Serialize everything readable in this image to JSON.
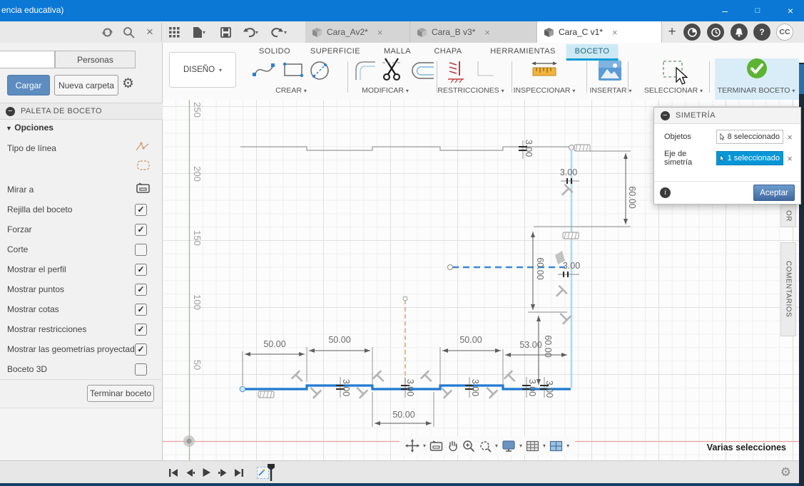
{
  "window": {
    "title_partial": "encia educativa)"
  },
  "header": {
    "doc_tabs": [
      {
        "label": "Cara_Av2*"
      },
      {
        "label": "Cara_B v3*"
      },
      {
        "label": "Cara_C v1*"
      }
    ],
    "avatar": "CC"
  },
  "ribbon": {
    "design_menu": "DISEÑO",
    "tabs": [
      {
        "label": "SOLIDO"
      },
      {
        "label": "SUPERFICIE"
      },
      {
        "label": "MALLA"
      },
      {
        "label": "CHAPA"
      },
      {
        "label": "HERRAMIENTAS"
      },
      {
        "label": "BOCETO"
      }
    ],
    "active_tab": "BOCETO",
    "groups": [
      {
        "label": "CREAR"
      },
      {
        "label": "MODIFICAR"
      },
      {
        "label": "RESTRICCIONES"
      },
      {
        "label": "INSPECCIONAR"
      },
      {
        "label": "INSERTAR"
      },
      {
        "label": "SELECCIONAR"
      }
    ],
    "finish_group": "TERMINAR BOCETO"
  },
  "left_panel": {
    "tab_blank": "",
    "tab_personas": "Personas",
    "load_button": "Cargar",
    "new_folder_button": "Nueva carpeta",
    "palette_title": "PALETA DE BOCETO",
    "options_header": "Opciones",
    "options": [
      {
        "label": "Tipo de línea",
        "control": "icon"
      },
      {
        "label": "",
        "control": "icon"
      },
      {
        "label": "Mirar a",
        "control": "icon"
      },
      {
        "label": "Rejilla del boceto",
        "control": "checkbox",
        "checked": true
      },
      {
        "label": "Forzar",
        "control": "checkbox",
        "checked": true
      },
      {
        "label": "Corte",
        "control": "checkbox",
        "checked": false
      },
      {
        "label": "Mostrar el perfil",
        "control": "checkbox",
        "checked": true
      },
      {
        "label": "Mostrar puntos",
        "control": "checkbox",
        "checked": true
      },
      {
        "label": "Mostrar cotas",
        "control": "checkbox",
        "checked": true
      },
      {
        "label": "Mostrar restricciones",
        "control": "checkbox",
        "checked": true
      },
      {
        "label": "Mostrar las geometrías proyectadas",
        "control": "checkbox",
        "checked": true
      },
      {
        "label": "Boceto 3D",
        "control": "checkbox",
        "checked": false
      }
    ],
    "finish_button": "Terminar boceto"
  },
  "dialog": {
    "title": "SIMETRÍA",
    "rows": [
      {
        "label": "Objetos",
        "value": "8 seleccionado"
      },
      {
        "label": "Eje de simetría",
        "value": "1 seleccionado"
      }
    ],
    "ok_button": "Aceptar"
  },
  "canvas": {
    "ruler_labels": [
      "250",
      "200",
      "150",
      "100",
      "50"
    ],
    "dims": {
      "d1": "50.00",
      "d2": "50.00",
      "d3": "50.00",
      "d4": "53.00",
      "d5": "50.00",
      "s1": "3.00",
      "s2": "3.00",
      "s3": "3.00",
      "s4": "3.00",
      "s5": "3.00",
      "t1": "3.00",
      "t2": "3.00",
      "t3": "3.00",
      "v1": "60.00",
      "v2": "60.00",
      "v3": "60.00"
    },
    "status": "Varias selecciones",
    "right_tabs": [
      {
        "label": "OR"
      },
      {
        "label": "COMENTARIOS"
      }
    ]
  },
  "colors": {
    "accent": "#0696d7",
    "selected_geometry": "#1f7ad0",
    "axis_x_red": "#e5a0a0",
    "axis_y_green": "#8fca77",
    "construction_orange": "#dca46a",
    "finish_green": "#5cb431"
  }
}
